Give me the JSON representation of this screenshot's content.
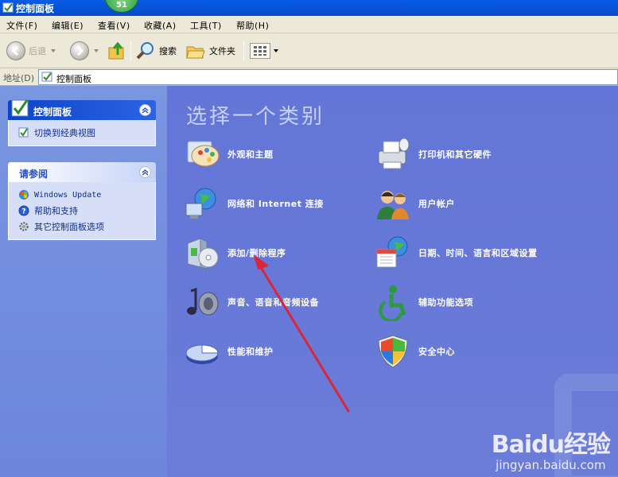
{
  "window": {
    "title": "控制面板",
    "badge": "51"
  },
  "menu": {
    "items": [
      "文件(F)",
      "编辑(E)",
      "查看(V)",
      "收藏(A)",
      "工具(T)",
      "帮助(H)"
    ]
  },
  "toolbar": {
    "back_label": "后退",
    "search_label": "搜索",
    "folders_label": "文件夹"
  },
  "address": {
    "label": "地址(D)",
    "value": "控制面板"
  },
  "sidebar": {
    "panel_title": "控制面板",
    "panel_links": [
      "切换到经典视图"
    ],
    "see_also_title": "请参阅",
    "see_also_links": [
      "Windows Update",
      "帮助和支持",
      "其它控制面板选项"
    ]
  },
  "main": {
    "heading": "选择一个类别",
    "categories": [
      "外观和主题",
      "打印机和其它硬件",
      "网络和 Internet 连接",
      "用户帐户",
      "添加/删除程序",
      "日期、时间、语言和区域设置",
      "声音、语音和音频设备",
      "辅助功能选项",
      "性能和维护",
      "安全中心"
    ]
  },
  "watermark": {
    "brand": "Baidu经验",
    "url": "jingyan.baidu.com"
  },
  "colors": {
    "content_bg": "#6375d6",
    "title_bar": "#0553d6",
    "annotation_arrow": "#d9263a"
  }
}
